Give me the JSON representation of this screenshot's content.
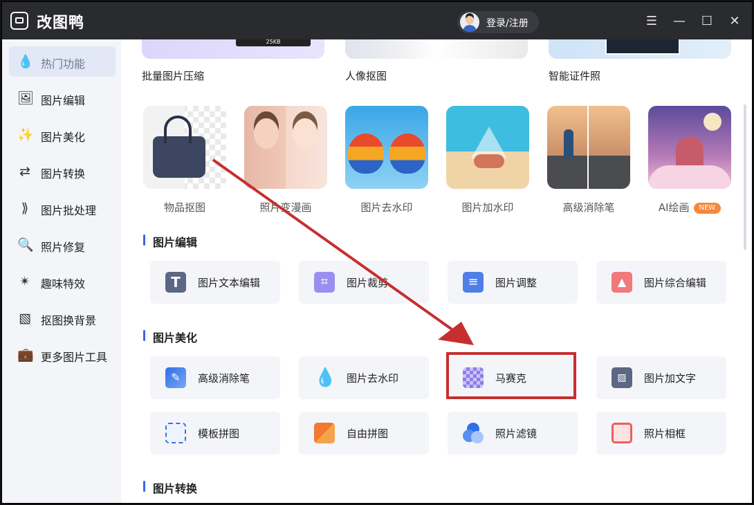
{
  "app": {
    "name": "改图鸭",
    "login_label": "登录/注册"
  },
  "window_controls": {
    "menu": "☰",
    "minimize": "—",
    "maximize": "☐",
    "close": "✕"
  },
  "sidebar": {
    "items": [
      {
        "label": "热门功能",
        "icon": "fire-drop-icon",
        "active": true
      },
      {
        "label": "图片编辑",
        "icon": "image-edit-icon"
      },
      {
        "label": "图片美化",
        "icon": "image-beautify-icon"
      },
      {
        "label": "图片转换",
        "icon": "image-convert-icon"
      },
      {
        "label": "图片批处理",
        "icon": "batch-process-icon"
      },
      {
        "label": "照片修复",
        "icon": "photo-repair-icon"
      },
      {
        "label": "趣味特效",
        "icon": "magic-effect-icon"
      },
      {
        "label": "抠图换背景",
        "icon": "cutout-background-icon"
      },
      {
        "label": "更多图片工具",
        "icon": "toolbox-icon"
      }
    ]
  },
  "top_cards": [
    {
      "label": "批量图片压缩"
    },
    {
      "label": "人像抠图"
    },
    {
      "label": "智能证件照"
    }
  ],
  "top_card_overlay": "25KB",
  "featured": [
    {
      "label": "物品抠图"
    },
    {
      "label": "照片变漫画"
    },
    {
      "label": "图片去水印"
    },
    {
      "label": "图片加水印"
    },
    {
      "label": "高级消除笔"
    },
    {
      "label": "AI绘画",
      "badge": "NEW"
    }
  ],
  "sections": [
    {
      "title": "图片编辑",
      "tools": [
        {
          "label": "图片文本编辑",
          "icon": "text-edit-icon"
        },
        {
          "label": "图片裁剪",
          "icon": "crop-icon"
        },
        {
          "label": "图片调整",
          "icon": "adjust-icon"
        },
        {
          "label": "图片综合编辑",
          "icon": "comprehensive-edit-icon"
        }
      ]
    },
    {
      "title": "图片美化",
      "tools": [
        {
          "label": "高级消除笔",
          "icon": "eraser-pen-icon"
        },
        {
          "label": "图片去水印",
          "icon": "watermark-drop-icon"
        },
        {
          "label": "马赛克",
          "icon": "mosaic-icon"
        },
        {
          "label": "图片加文字",
          "icon": "add-text-icon"
        },
        {
          "label": "模板拼图",
          "icon": "template-collage-icon"
        },
        {
          "label": "自由拼图",
          "icon": "free-collage-icon"
        },
        {
          "label": "照片滤镜",
          "icon": "filter-icon"
        },
        {
          "label": "照片相框",
          "icon": "photo-frame-icon"
        }
      ]
    },
    {
      "title": "图片转换",
      "tools": []
    }
  ],
  "colors": {
    "accent": "#3a66e8",
    "highlight": "#c62f2f",
    "titlebar": "#2a2b2f"
  }
}
